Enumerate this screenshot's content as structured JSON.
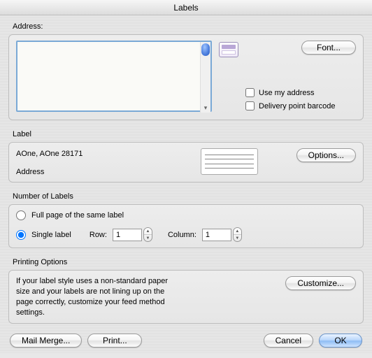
{
  "window": {
    "title": "Labels"
  },
  "address": {
    "group_label": "Address:",
    "text_value": "",
    "font_button": "Font...",
    "use_my_address_label": "Use my address",
    "use_my_address_checked": false,
    "delivery_barcode_label": "Delivery point barcode",
    "delivery_barcode_checked": false
  },
  "label": {
    "group_label": "Label",
    "product": "AOne, AOne 28171",
    "kind": "Address",
    "options_button": "Options..."
  },
  "numlabels": {
    "group_label": "Number of Labels",
    "full_page_label": "Full page of the same label",
    "single_label": "Single label",
    "selected": "single",
    "row_label": "Row:",
    "row_value": "1",
    "column_label": "Column:",
    "column_value": "1"
  },
  "printing": {
    "group_label": "Printing Options",
    "hint": "If your label style uses a non-standard paper size and your labels are not lining up on the page correctly, customize your feed method settings.",
    "customize_button": "Customize..."
  },
  "buttons": {
    "mail_merge": "Mail Merge...",
    "print": "Print...",
    "cancel": "Cancel",
    "ok": "OK"
  }
}
